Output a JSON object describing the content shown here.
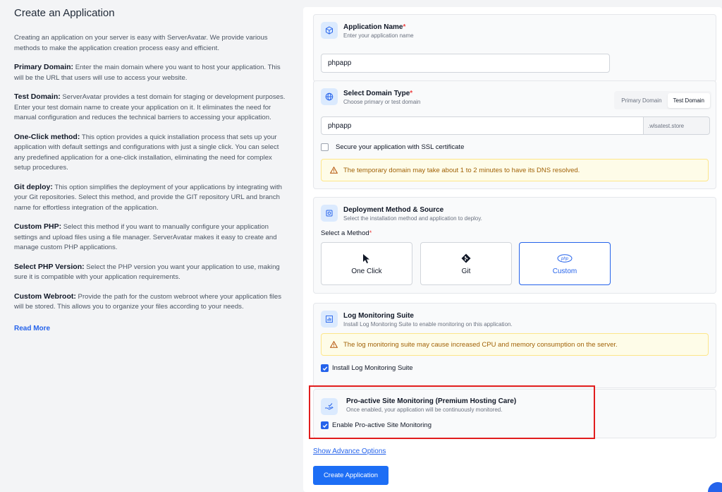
{
  "left": {
    "title": "Create an Application",
    "intro": "Creating an application on your server is easy with ServerAvatar. We provide various methods to make the application creation process easy and efficient.",
    "sections": [
      {
        "term": "Primary Domain:",
        "text": " Enter the main domain where you want to host your application. This will be the URL that users will use to access your website."
      },
      {
        "term": "Test Domain:",
        "text": " ServerAvatar provides a test domain for staging or development purposes. Enter your test domain name to create your application on it. It eliminates the need for manual configuration and reduces the technical barriers to accessing your application."
      },
      {
        "term": "One-Click method:",
        "text": " This option provides a quick installation process that sets up your application with default settings and configurations with just a single click. You can select any predefined application for a one-click installation, eliminating the need for complex setup procedures."
      },
      {
        "term": "Git deploy:",
        "text": " This option simplifies the deployment of your applications by integrating with your Git repositories. Select this method, and provide the GIT repository URL and branch name for effortless integration of the application."
      },
      {
        "term": "Custom PHP:",
        "text": " Select this method if you want to manually configure your application settings and upload files using a file manager. ServerAvatar makes it easy to create and manage custom PHP applications."
      },
      {
        "term": "Select PHP Version:",
        "text": " Select the PHP version you want your application to use, making sure it is compatible with your application requirements."
      },
      {
        "term": "Custom Webroot:",
        "text": " Provide the path for the custom webroot where your application files will be stored. This allows you to organize your files according to your needs."
      }
    ],
    "read_more": "Read More"
  },
  "app_name": {
    "title": "Application Name",
    "required": "*",
    "subtitle": "Enter your application name",
    "value": "phpapp"
  },
  "domain": {
    "title": "Select Domain Type",
    "required": "*",
    "subtitle": "Choose primary or test domain",
    "tabs": [
      "Primary Domain",
      "Test Domain"
    ],
    "active_tab": "Test Domain",
    "value": "phpapp",
    "suffix": ".wlsatest.store",
    "ssl_label": "Secure your application with SSL certificate",
    "ssl_checked": false,
    "warning": "The temporary domain may take about 1 to 2 minutes to have its DNS resolved."
  },
  "deploy": {
    "title": "Deployment Method & Source",
    "subtitle": "Select the installation method and application to deploy.",
    "method_label": "Select a Method",
    "required": "*",
    "methods": [
      {
        "label": "One Click",
        "icon": "cursor-icon"
      },
      {
        "label": "Git",
        "icon": "git-icon"
      },
      {
        "label": "Custom",
        "icon": "php-icon",
        "icon_text": "php"
      }
    ],
    "selected": "Custom"
  },
  "log": {
    "title": "Log Monitoring Suite",
    "subtitle": "Install Log Monitoring Suite to enable monitoring on this application.",
    "warning": "The log monitoring suite may cause increased CPU and memory consumption on the server.",
    "checkbox_label": "Install Log Monitoring Suite",
    "checked": true
  },
  "proactive": {
    "title": "Pro-active Site Monitoring (Premium Hosting Care)",
    "subtitle": "Once enabled, your application will be continuously monitored.",
    "checkbox_label": "Enable Pro-active Site Monitoring",
    "checked": true
  },
  "footer": {
    "advance_link": "Show Advance Options",
    "submit": "Create Application"
  },
  "colors": {
    "accent": "#2563eb",
    "warning_bg": "#fefce8",
    "highlight": "#e11d1d"
  }
}
